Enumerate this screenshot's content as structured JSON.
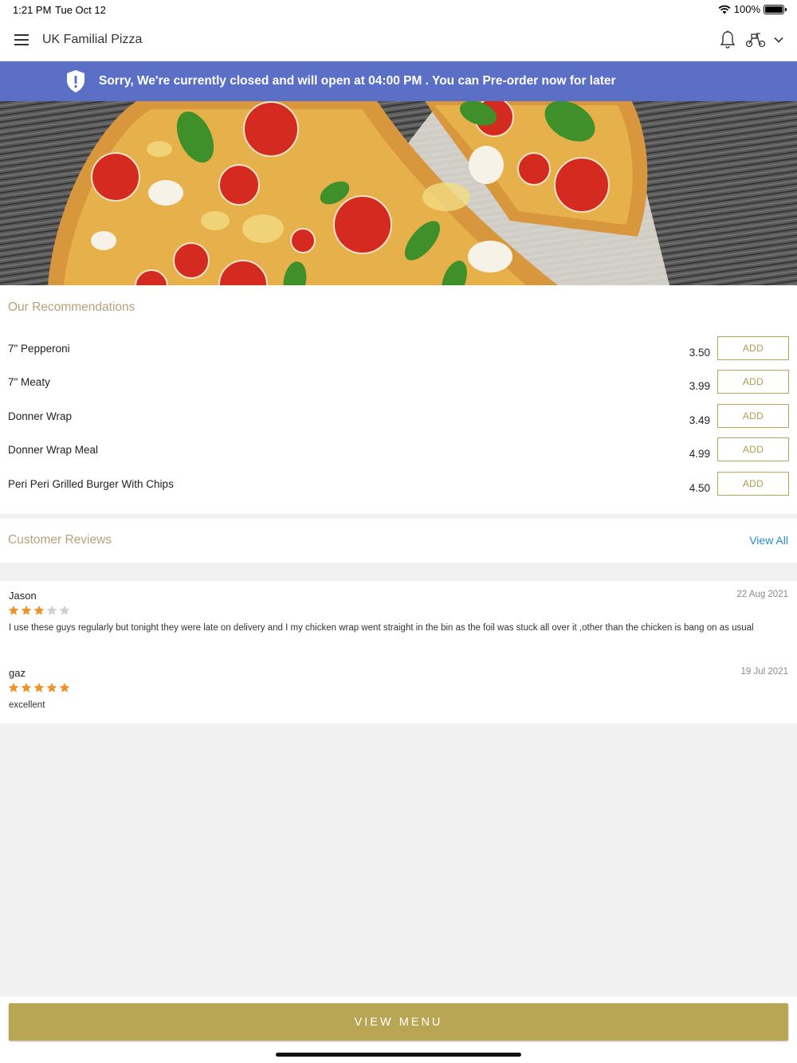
{
  "status_bar": {
    "time": "1:21 PM",
    "date": "Tue Oct 12",
    "battery": "100%"
  },
  "header": {
    "title": "UK Familial Pizza",
    "icons": [
      "menu-icon",
      "bell-icon",
      "scooter-icon",
      "chevron-down-icon"
    ]
  },
  "notice": {
    "text": "Sorry, We're currently closed and will open at 04:00 PM . You can Pre-order now for later",
    "color": "#5c6fc6"
  },
  "recommendations": {
    "title": "Our Recommendations",
    "add_label": "ADD",
    "items": [
      {
        "name": "7\" Pepperoni",
        "price": "3.50"
      },
      {
        "name": "7\" Meaty",
        "price": "3.99"
      },
      {
        "name": "Donner Wrap",
        "price": "3.49"
      },
      {
        "name": "Donner Wrap Meal",
        "price": "4.99"
      },
      {
        "name": "Peri Peri Grilled Burger With Chips",
        "price": "4.50"
      }
    ]
  },
  "reviews": {
    "title": "Customer Reviews",
    "view_all": "View All",
    "items": [
      {
        "name": "Jason",
        "date": "22 Aug 2021",
        "rating": 3,
        "text": "I use these guys  regularly but tonight they were late on delivery and I my chicken wrap went straight in the bin as the foil was stuck all over  it ,other than the chicken is bang on as usual"
      },
      {
        "name": "gaz",
        "date": "19 Jul 2021",
        "rating": 5,
        "text": "excellent"
      }
    ]
  },
  "footer": {
    "view_menu": "VIEW MENU"
  },
  "colors": {
    "accent_gold": "#b8a655",
    "section_title": "#b6a27a",
    "link_blue": "#2a8ac4",
    "star_orange": "#f0932b",
    "star_empty": "#d0d0d0"
  }
}
